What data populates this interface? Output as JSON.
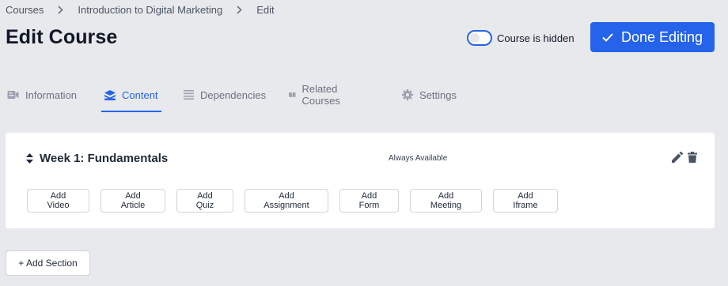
{
  "breadcrumb": {
    "items": [
      "Courses",
      "Introduction to Digital Marketing",
      "Edit"
    ]
  },
  "page": {
    "title": "Edit Course"
  },
  "visibility": {
    "label": "Course is hidden",
    "enabled": false
  },
  "header": {
    "done_label": "Done Editing"
  },
  "tabs": [
    {
      "label": "Information",
      "icon": "video-card-icon",
      "active": false
    },
    {
      "label": "Content",
      "icon": "layers-icon",
      "active": true
    },
    {
      "label": "Dependencies",
      "icon": "list-icon",
      "active": false
    },
    {
      "label": "Related Courses",
      "icon": "book-open-icon",
      "active": false
    },
    {
      "label": "Settings",
      "icon": "gear-icon",
      "active": false
    }
  ],
  "section": {
    "title": "Week 1: Fundamentals",
    "availability": "Always Available",
    "add_buttons": [
      "Add Video",
      "Add Article",
      "Add Quiz",
      "Add Assignment",
      "Add Form",
      "Add Meeting",
      "Add Iframe"
    ]
  },
  "footer": {
    "add_section_label": "+ Add Section"
  },
  "colors": {
    "accent": "#2563eb",
    "background": "#e8e9ed",
    "card": "#ffffff",
    "muted_text": "#6b7280"
  }
}
